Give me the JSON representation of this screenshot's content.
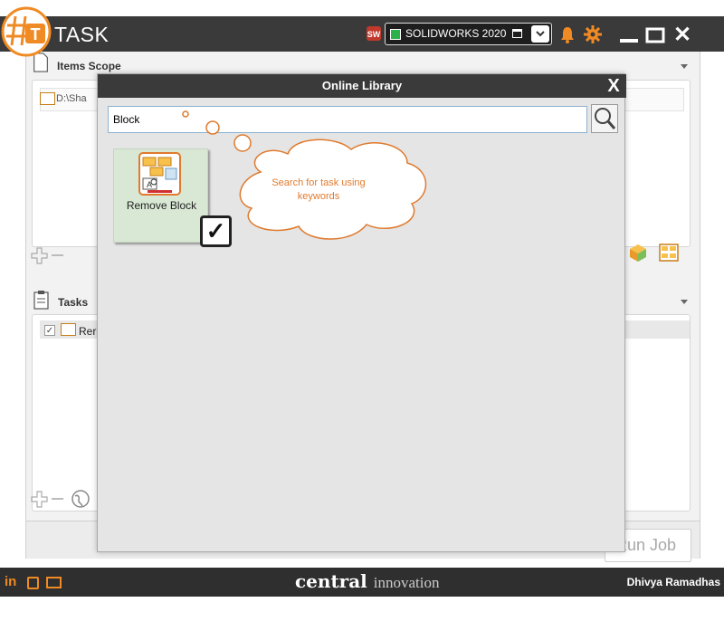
{
  "app": {
    "title": "TASK",
    "product_selected": "SOLIDWORKS 2020"
  },
  "items_scope": {
    "label": "Items Scope",
    "path_text": "D:\\Sha"
  },
  "tasks": {
    "label": "Tasks",
    "row_text": "Rer",
    "row_checked": true
  },
  "run_button": {
    "label": "Run Job"
  },
  "footer": {
    "brand_bold": "central",
    "brand_light": "innovation",
    "user_name": "Dhivya Ramadhas",
    "social_linkedin": "in"
  },
  "dialog": {
    "title": "Online Library",
    "close_label": "X",
    "search_value": "Block",
    "results": [
      {
        "label": "Remove Block",
        "selected": true
      }
    ]
  },
  "annotation": {
    "text": "Search for task using keywords",
    "color": "#e07a2e"
  },
  "colors": {
    "titlebar": "#3a3a3a",
    "accent_orange": "#f08a24",
    "tile_background": "#d8e8d4"
  },
  "icons": {
    "logo": "hashtag-t-logo-icon",
    "solidworks": "solidworks-icon",
    "bell": "bell-icon",
    "gear": "gear-icon",
    "search": "magnifier-icon",
    "task_tile": "remove-block-icon"
  }
}
